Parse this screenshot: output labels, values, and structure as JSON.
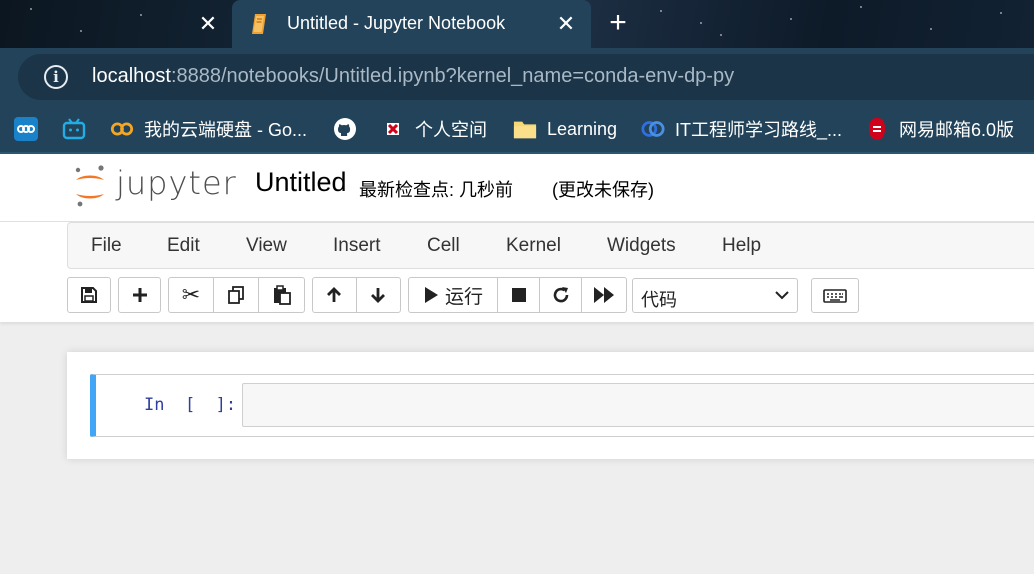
{
  "browser": {
    "tab_title": "Untitled - Jupyter Notebook",
    "url_host": "localhost",
    "url_rest": ":8888/notebooks/Untitled.ipynb?kernel_name=conda-env-dp-py",
    "bookmarks": [
      {
        "label": "",
        "icon": "nextcloud-icon"
      },
      {
        "label": "",
        "icon": "bilibili-icon"
      },
      {
        "label": "我的云端硬盘 - Go...",
        "icon": "cloud-drive-icon"
      },
      {
        "label": "",
        "icon": "github-icon"
      },
      {
        "label": "个人空间",
        "icon": "personal-space-icon"
      },
      {
        "label": "Learning",
        "icon": "folder-icon"
      },
      {
        "label": "IT工程师学习路线_...",
        "icon": "learning-path-icon"
      },
      {
        "label": "网易邮箱6.0版",
        "icon": "netease-mail-icon"
      }
    ]
  },
  "jupyter": {
    "logo_text": "jupyter",
    "notebook_name": "Untitled",
    "checkpoint": "最新检查点: 几秒前",
    "autosave": "(更改未保存)",
    "menu": [
      "File",
      "Edit",
      "View",
      "Insert",
      "Cell",
      "Kernel",
      "Widgets",
      "Help"
    ],
    "run_label": "运行",
    "cell_type": "代码",
    "prompt": "In [ ]:"
  },
  "colors": {
    "browser_bg": "#22435a",
    "cell_selected_border": "#42a5f5",
    "jupyter_orange": "#f37726",
    "prompt_color": "#303f9f"
  }
}
